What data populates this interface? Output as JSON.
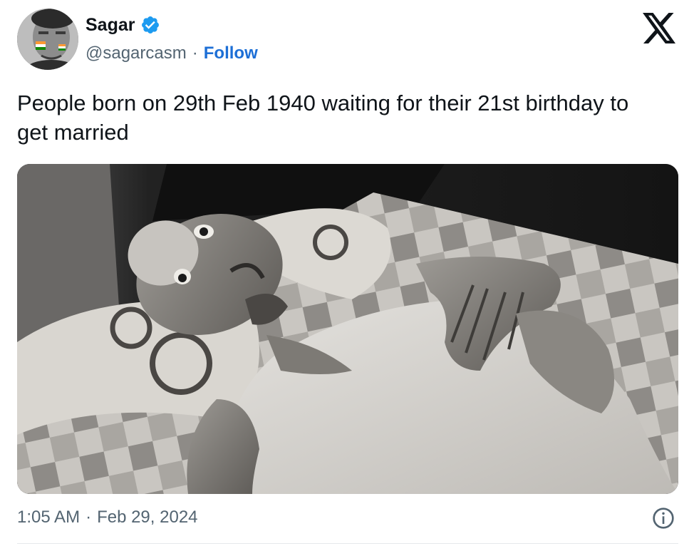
{
  "author": {
    "display_name": "Sagar",
    "handle": "@sagarcasm",
    "separator": "·",
    "follow_label": "Follow",
    "verified_color": "#1d9bf0"
  },
  "tweet": {
    "text": "People born on 29th Feb 1940 waiting for their 21st birthday to get married"
  },
  "media": {
    "icon": "photo"
  },
  "meta": {
    "time": "1:05 AM",
    "separator": "·",
    "date": "Feb 29, 2024"
  },
  "icons": {
    "brand": "x-logo-icon",
    "info": "info-icon",
    "verified": "verified-badge-icon"
  },
  "colors": {
    "link": "#1d6fd6",
    "muted": "#536471",
    "text": "#0f1419"
  }
}
